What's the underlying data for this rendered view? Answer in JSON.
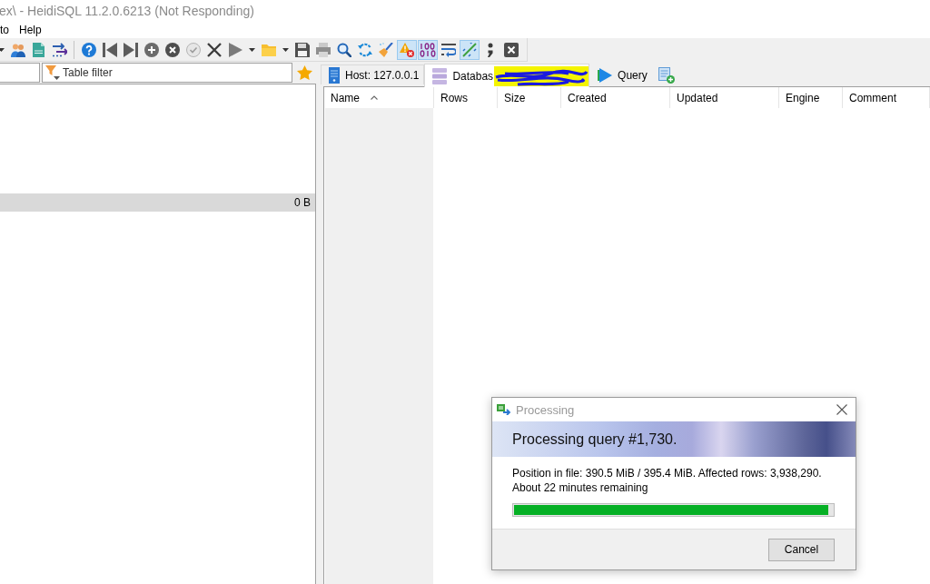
{
  "window": {
    "title": "ex\\ - HeidiSQL 11.2.0.6213 (Not Responding)"
  },
  "menu": [
    {
      "label": "to"
    },
    {
      "label": "Help"
    }
  ],
  "toolbar": {
    "toggles": [
      {
        "pressed": true
      },
      {
        "pressed": true
      },
      {
        "pressed": false
      },
      {
        "pressed": true
      }
    ]
  },
  "table_filter": {
    "placeholder": "Table filter"
  },
  "tree": {
    "rows": [
      {
        "size": "0 B",
        "selected": true
      }
    ]
  },
  "tabs": [
    {
      "kind": "host",
      "label": "Host: 127.0.0.1",
      "selected": false,
      "redacted": false
    },
    {
      "kind": "database",
      "label": "Databas",
      "selected": true,
      "redacted": true
    },
    {
      "kind": "query",
      "label": "Query",
      "selected": false,
      "redacted": false
    }
  ],
  "table": {
    "columns": [
      {
        "label": "Name",
        "sorted": true
      },
      {
        "label": "Rows",
        "sorted": false
      },
      {
        "label": "Size",
        "sorted": false
      },
      {
        "label": "Created",
        "sorted": false
      },
      {
        "label": "Updated",
        "sorted": false
      },
      {
        "label": "Engine",
        "sorted": false
      },
      {
        "label": "Comment",
        "sorted": false
      }
    ]
  },
  "dialog": {
    "title": "Processing",
    "heading": "Processing query #1,730.",
    "status": "Position in file: 390.5 MiB / 395.4 MiB. Affected rows: 3,938,290.",
    "remaining": "About 22 minutes remaining",
    "progress": {
      "level": 0.986
    },
    "buttons": [
      {
        "label": "Cancel"
      }
    ]
  }
}
